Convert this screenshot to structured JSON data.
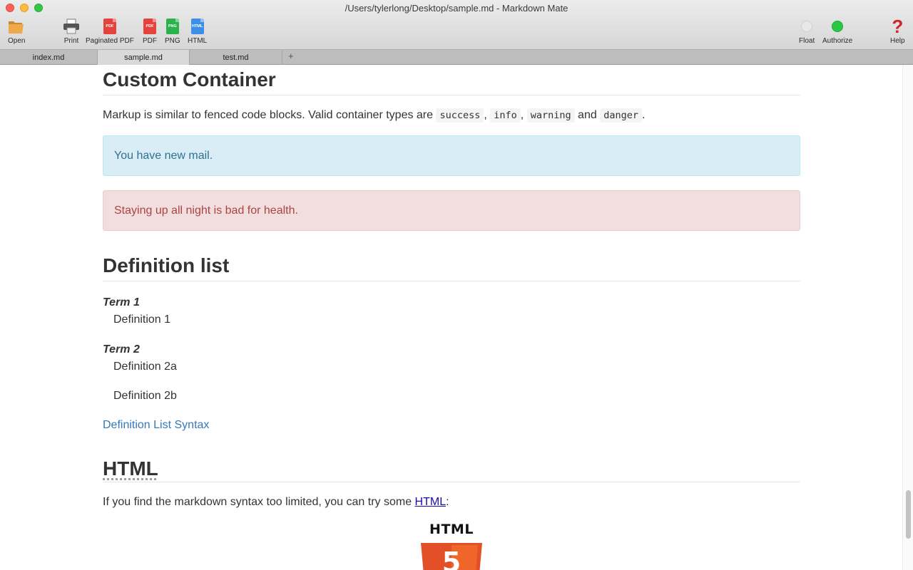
{
  "window": {
    "title": "/Users/tylerlong/Desktop/sample.md - Markdown Mate"
  },
  "toolbar": {
    "open": "Open",
    "print": "Print",
    "paginated_pdf": "Paginated PDF",
    "pdf": "PDF",
    "png": "PNG",
    "html": "HTML",
    "float": "Float",
    "authorize": "Authorize",
    "help": "Help",
    "pdf_icon_text": "PDF",
    "png_icon_text": "PNG",
    "html_icon_text": "HTML",
    "help_icon_text": "?"
  },
  "tabs": [
    {
      "label": "index.md"
    },
    {
      "label": "sample.md"
    },
    {
      "label": "test.md"
    }
  ],
  "tab_add": "+",
  "doc": {
    "custom_container": {
      "heading": "Custom Container",
      "intro_1": "Markup is similar to fenced code blocks. Valid container types are ",
      "types": [
        "success",
        "info",
        "warning",
        "danger"
      ],
      "sep_comma": ", ",
      "sep_and": " and ",
      "end": ".",
      "info_alert": "You have new mail.",
      "danger_alert": "Staying up all night is bad for health."
    },
    "definition_list": {
      "heading": "Definition list",
      "term1": "Term 1",
      "def1": "Definition 1",
      "term2": "Term 2",
      "def2a": "Definition 2a",
      "def2b": "Definition 2b",
      "link": "Definition List Syntax"
    },
    "html_section": {
      "heading": "HTML",
      "text": "If you find the markdown syntax too limited, you can try some ",
      "link": "HTML",
      "after": ":",
      "logo_text": "HTML",
      "logo_digit": "5"
    }
  },
  "colors": {
    "info_bg": "#d9edf7",
    "danger_bg": "#f2dede",
    "link": "#337ab7",
    "html5_orange": "#e34f26",
    "authorize_dot": "#28c840"
  }
}
